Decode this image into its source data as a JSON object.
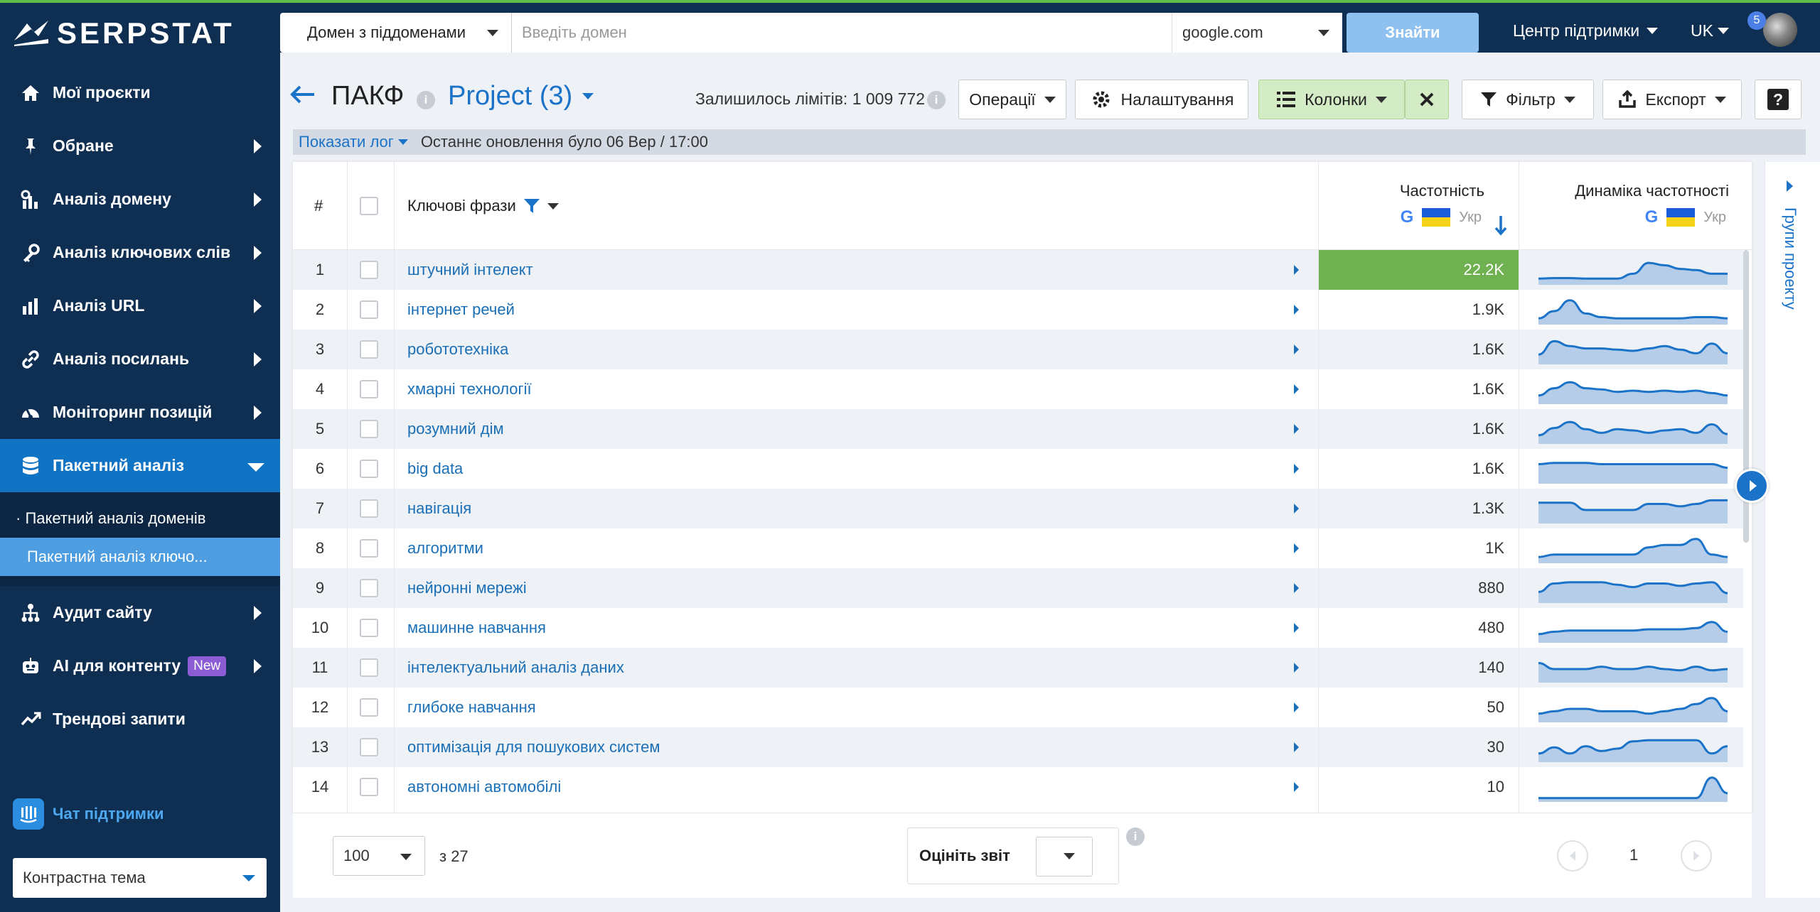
{
  "brand": {
    "name": "SERPSTAT"
  },
  "sidebar": {
    "items": [
      {
        "label": "Мої проєкти",
        "icon": "home-icon"
      },
      {
        "label": "Обране",
        "icon": "pin-icon"
      },
      {
        "label": "Аналіз домену",
        "icon": "domain-analysis-icon"
      },
      {
        "label": "Аналіз ключових слів",
        "icon": "key-icon"
      },
      {
        "label": "Аналіз URL",
        "icon": "bar-chart-icon"
      },
      {
        "label": "Аналіз посилань",
        "icon": "link-icon"
      },
      {
        "label": "Моніторинг позицій",
        "icon": "gauge-icon"
      },
      {
        "label": "Пакетний аналіз",
        "icon": "database-icon"
      }
    ],
    "sub_items": [
      {
        "label": "· Пакетний аналіз доменів"
      },
      {
        "label": "Пакетний аналіз ключо..."
      }
    ],
    "items_after": [
      {
        "label": "Аудит сайту",
        "icon": "sitemap-icon"
      },
      {
        "label": "AI для контенту",
        "icon": "robot-icon",
        "badge": "New"
      },
      {
        "label": "Трендові запити",
        "icon": "trend-icon"
      }
    ],
    "chat_label": "Чат підтримки",
    "theme_label": "Контрастна тема"
  },
  "topbar": {
    "domain_mode": "Домен з піддоменами",
    "domain_placeholder": "Введіть домен",
    "engine": "google.com",
    "find_label": "Знайти",
    "support_label": "Центр підтримки",
    "lang": "UK",
    "notifications": "5"
  },
  "header": {
    "title": "ПАКФ",
    "project": "Project (3)",
    "limits": "Залишилось лімітів: 1 009 772",
    "operations_label": "Операції",
    "settings_label": "Налаштування",
    "columns_label": "Колонки",
    "filter_label": "Фільтр",
    "export_label": "Експорт",
    "help_label": "?"
  },
  "logbar": {
    "show_log": "Показати лог",
    "last_update": "Останнє оновлення було 06 Вер / 17:00"
  },
  "table": {
    "col_num": "#",
    "col_keyword": "Ключові фрази",
    "col_volume": "Частотність",
    "col_dynamics": "Динаміка частотності",
    "region": "Укр",
    "rows": [
      {
        "n": "1",
        "kw": "штучний інтелект",
        "vol": "22.2K",
        "trend": [
          0.2,
          0.22,
          0.22,
          0.2,
          0.2,
          0.2,
          0.4,
          0.85,
          0.75,
          0.6,
          0.55,
          0.4,
          0.4
        ]
      },
      {
        "n": "2",
        "kw": "інтернет речей",
        "vol": "1.9K",
        "trend": [
          0.2,
          0.5,
          0.95,
          0.4,
          0.25,
          0.2,
          0.2,
          0.2,
          0.2,
          0.2,
          0.25,
          0.25,
          0.2
        ]
      },
      {
        "n": "3",
        "kw": "робототехніка",
        "vol": "1.6K",
        "trend": [
          0.35,
          0.9,
          0.7,
          0.6,
          0.6,
          0.55,
          0.5,
          0.6,
          0.7,
          0.55,
          0.4,
          0.8,
          0.4
        ]
      },
      {
        "n": "4",
        "kw": "хмарні технології",
        "vol": "1.6K",
        "trend": [
          0.3,
          0.6,
          0.85,
          0.6,
          0.55,
          0.45,
          0.5,
          0.45,
          0.5,
          0.45,
          0.5,
          0.4,
          0.3
        ]
      },
      {
        "n": "5",
        "kw": "розумний дім",
        "vol": "1.6K",
        "trend": [
          0.3,
          0.6,
          0.85,
          0.55,
          0.4,
          0.55,
          0.5,
          0.4,
          0.5,
          0.55,
          0.4,
          0.75,
          0.35
        ]
      },
      {
        "n": "6",
        "kw": "big data",
        "vol": "1.6K",
        "trend": [
          0.75,
          0.8,
          0.8,
          0.8,
          0.75,
          0.75,
          0.75,
          0.75,
          0.75,
          0.75,
          0.75,
          0.75,
          0.6
        ]
      },
      {
        "n": "7",
        "kw": "навігація",
        "vol": "1.3K",
        "trend": [
          0.8,
          0.8,
          0.8,
          0.5,
          0.5,
          0.5,
          0.5,
          0.75,
          0.75,
          0.65,
          0.75,
          0.9,
          0.9
        ]
      },
      {
        "n": "8",
        "kw": "алгоритми",
        "vol": "1K",
        "trend": [
          0.2,
          0.3,
          0.3,
          0.3,
          0.3,
          0.3,
          0.3,
          0.6,
          0.7,
          0.7,
          0.95,
          0.3,
          0.2
        ]
      },
      {
        "n": "9",
        "kw": "нейронні мережі",
        "vol": "880",
        "trend": [
          0.4,
          0.75,
          0.8,
          0.8,
          0.8,
          0.7,
          0.6,
          0.75,
          0.75,
          0.65,
          0.75,
          0.8,
          0.35
        ]
      },
      {
        "n": "10",
        "kw": "машинне навчання",
        "vol": "480",
        "trend": [
          0.3,
          0.4,
          0.45,
          0.45,
          0.45,
          0.45,
          0.45,
          0.5,
          0.5,
          0.5,
          0.55,
          0.8,
          0.4
        ]
      },
      {
        "n": "11",
        "kw": "інтелектуальний аналіз даних",
        "vol": "140",
        "trend": [
          0.75,
          0.5,
          0.5,
          0.5,
          0.6,
          0.5,
          0.5,
          0.6,
          0.5,
          0.45,
          0.6,
          0.45,
          0.5
        ]
      },
      {
        "n": "12",
        "kw": "глибоке навчання",
        "vol": "50",
        "trend": [
          0.3,
          0.4,
          0.5,
          0.5,
          0.4,
          0.4,
          0.4,
          0.3,
          0.4,
          0.5,
          0.7,
          0.95,
          0.4
        ]
      },
      {
        "n": "13",
        "kw": "оптимізація для пошукових систем",
        "vol": "30",
        "trend": [
          0.3,
          0.55,
          0.3,
          0.6,
          0.4,
          0.5,
          0.8,
          0.85,
          0.85,
          0.85,
          0.85,
          0.3,
          0.6
        ]
      },
      {
        "n": "14",
        "kw": "автономні автомобілі",
        "vol": "10",
        "trend": [
          0.1,
          0.1,
          0.1,
          0.1,
          0.1,
          0.1,
          0.1,
          0.1,
          0.1,
          0.1,
          0.1,
          0.95,
          0.3
        ]
      }
    ]
  },
  "footer": {
    "per_page": "100",
    "of_total": "з 27",
    "rate_label": "Оцініть звіт",
    "page": "1"
  },
  "rightpanel": {
    "label": "Групи проекту"
  },
  "colors": {
    "sidebar": "#0f2f52",
    "accent": "#1a73c8",
    "highlight": "#6fb150",
    "active_nav": "#1173c3"
  }
}
